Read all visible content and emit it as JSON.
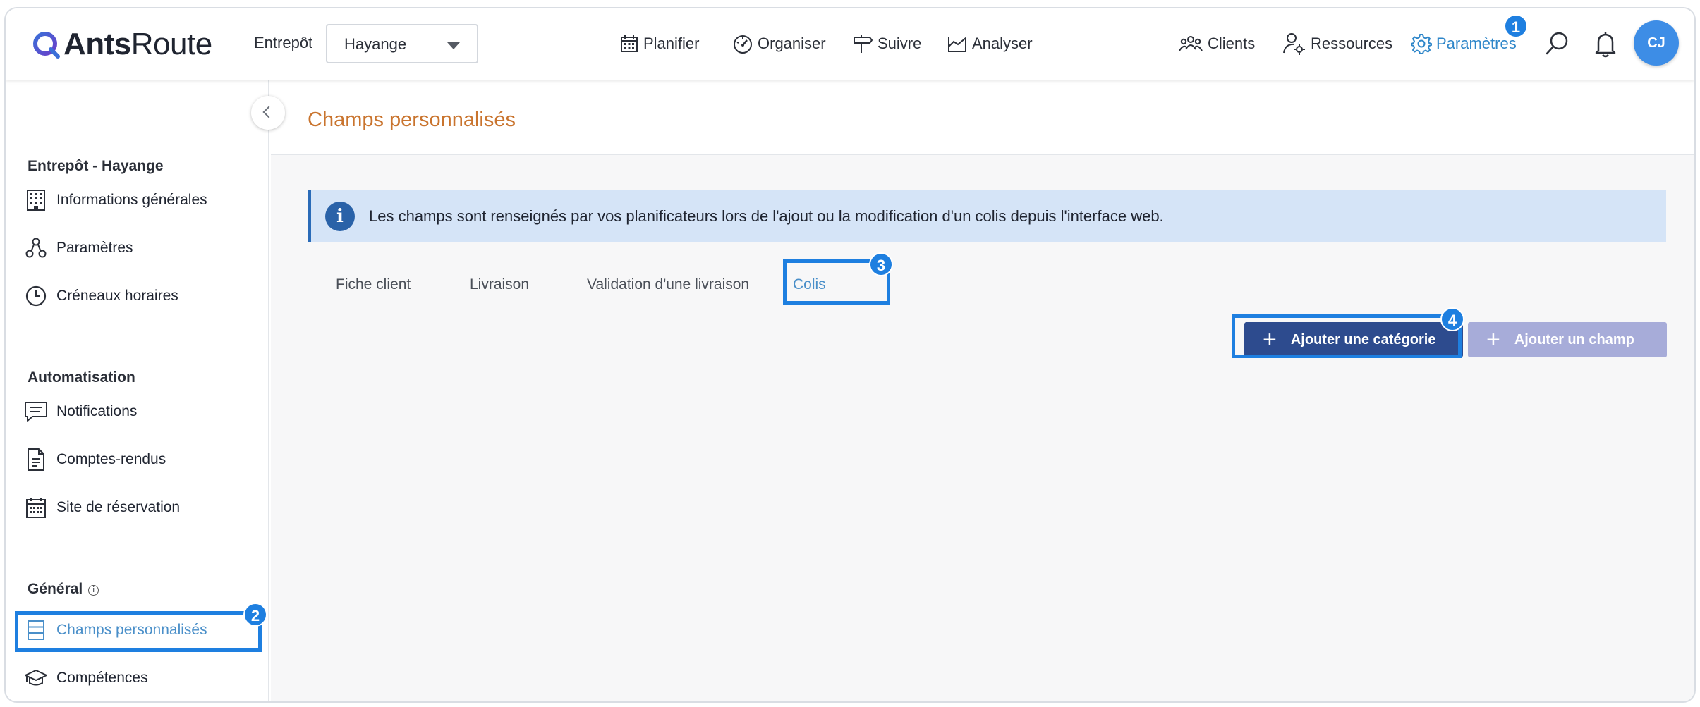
{
  "app": {
    "logo_bold": "Ants",
    "logo_rest": "Route"
  },
  "header": {
    "entrepot_label": "Entrepôt",
    "entrepot_value": "Hayange",
    "nav_center": [
      {
        "label": "Planifier",
        "icon": "calendar-icon"
      },
      {
        "label": "Organiser",
        "icon": "gauge-icon"
      },
      {
        "label": "Suivre",
        "icon": "signpost-icon"
      },
      {
        "label": "Analyser",
        "icon": "chart-area-icon"
      }
    ],
    "nav_right": [
      {
        "label": "Clients",
        "icon": "users-icon"
      },
      {
        "label": "Ressources",
        "icon": "user-gear-icon"
      },
      {
        "label": "Paramètres",
        "icon": "gear-icon"
      }
    ],
    "avatar_initials": "CJ"
  },
  "sidebar": {
    "section1_title": "Entrepôt - Hayange",
    "section1_items": [
      {
        "label": "Informations générales",
        "icon": "building-icon"
      },
      {
        "label": "Paramètres",
        "icon": "nodes-icon"
      },
      {
        "label": "Créneaux horaires",
        "icon": "clock-icon"
      }
    ],
    "section2_title": "Automatisation",
    "section2_items": [
      {
        "label": "Notifications",
        "icon": "message-icon"
      },
      {
        "label": "Comptes-rendus",
        "icon": "document-icon"
      },
      {
        "label": "Site de réservation",
        "icon": "calendar-grid-icon"
      }
    ],
    "section3_title": "Général",
    "section3_items": [
      {
        "label": "Champs personnalisés",
        "icon": "table-icon",
        "active": true
      },
      {
        "label": "Compétences",
        "icon": "graduation-cap-icon"
      }
    ]
  },
  "main": {
    "page_title": "Champs personnalisés",
    "alert_text": "Les champs sont renseignés par vos planificateurs lors de l'ajout ou la modification d'un colis depuis l'interface web.",
    "tabs": [
      {
        "label": "Fiche client"
      },
      {
        "label": "Livraison"
      },
      {
        "label": "Validation d'une livraison"
      },
      {
        "label": "Colis",
        "active": true
      }
    ],
    "add_category_label": "Ajouter une catégorie",
    "add_field_label": "Ajouter un champ"
  },
  "annotations": {
    "badge1": "1",
    "badge2": "2",
    "badge3": "3",
    "badge4": "4"
  },
  "colors": {
    "accent": "#1e7fe0",
    "title_orange": "#c9742e",
    "primary_button": "#2d4b8e",
    "disabled_button": "#a7acd9",
    "alert_bg": "#d5e4f7"
  }
}
